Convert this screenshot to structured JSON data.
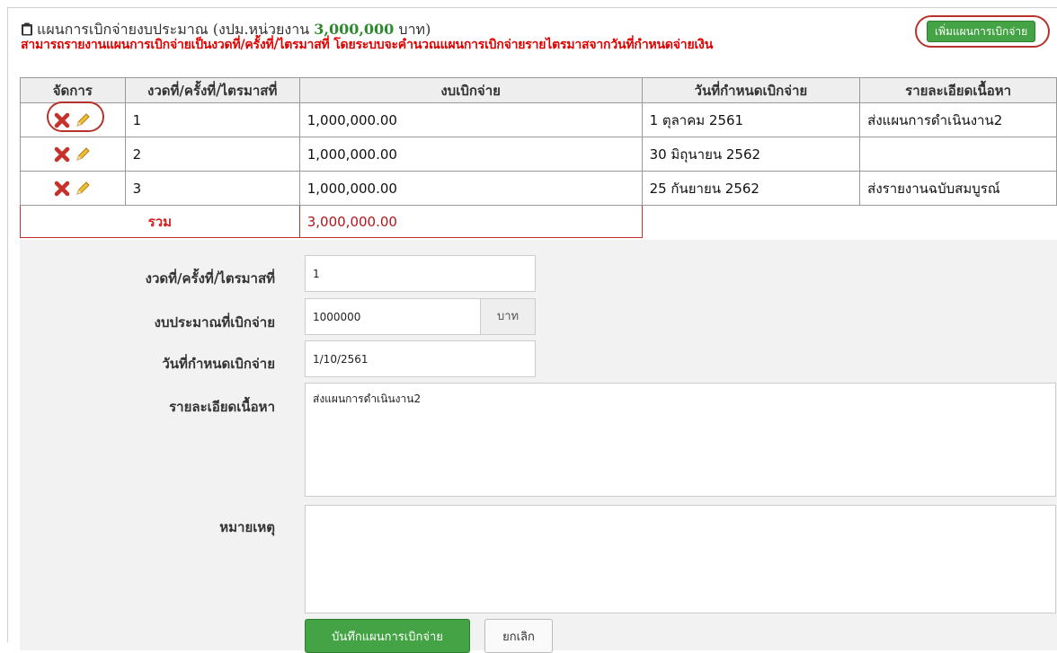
{
  "header": {
    "title_prefix": "แผนการเบิกจ่ายงบประมาณ (งปม.หน่วยงาน",
    "title_amount": "3,000,000",
    "title_suffix": "บาท)",
    "note": "สามารถรายงานแผนการเบิกจ่ายเป็นงวดที่/ครั้งที่/ไตรมาสที่ โดยระบบจะคำนวณแผนการเบิกจ่ายรายไตรมาสจากวันที่กำหนดจ่ายเงิน",
    "add_button": "เพิ่มแผนการเบิกจ่าย"
  },
  "table": {
    "columns": [
      "จัดการ",
      "งวดที่/ครั้งที่/ไตรมาสที่",
      "งบเบิกจ่าย",
      "วันที่กำหนดเบิกจ่าย",
      "รายละเอียดเนื้อหา"
    ],
    "rows": [
      {
        "period": "1",
        "amount": "1,000,000.00",
        "date": "1 ตุลาคม 2561",
        "detail": "ส่งแผนการดำเนินงาน2"
      },
      {
        "period": "2",
        "amount": "1,000,000.00",
        "date": "30 มิถุนายน 2562",
        "detail": ""
      },
      {
        "period": "3",
        "amount": "1,000,000.00",
        "date": "25 กันยายน 2562",
        "detail": "ส่งรายงานฉบับสมบูรณ์"
      }
    ],
    "total_label": "รวม",
    "total_value": "3,000,000.00"
  },
  "form": {
    "period_label": "งวดที่/ครั้งที่/ไตรมาสที่",
    "period_value": "1",
    "budget_label": "งบประมาณที่เบิกจ่าย",
    "budget_value": "1000000",
    "budget_unit": "บาท",
    "date_label": "วันที่กำหนดเบิกจ่าย",
    "date_value": "1/10/2561",
    "detail_label": "รายละเอียดเนื้อหา",
    "detail_value": "ส่งแผนการดำเนินงาน2",
    "remark_label": "หมายเหตุ",
    "remark_value": "",
    "save_button": "บันทึกแผนการเบิกจ่าย",
    "cancel_button": "ยกเลิก"
  },
  "colors": {
    "accent_green": "#44a344",
    "alert_red": "#e00000",
    "highlight_ring": "#b5332b"
  },
  "icons": [
    "clipboard-icon",
    "delete-icon",
    "edit-icon",
    "minus-icon"
  ]
}
